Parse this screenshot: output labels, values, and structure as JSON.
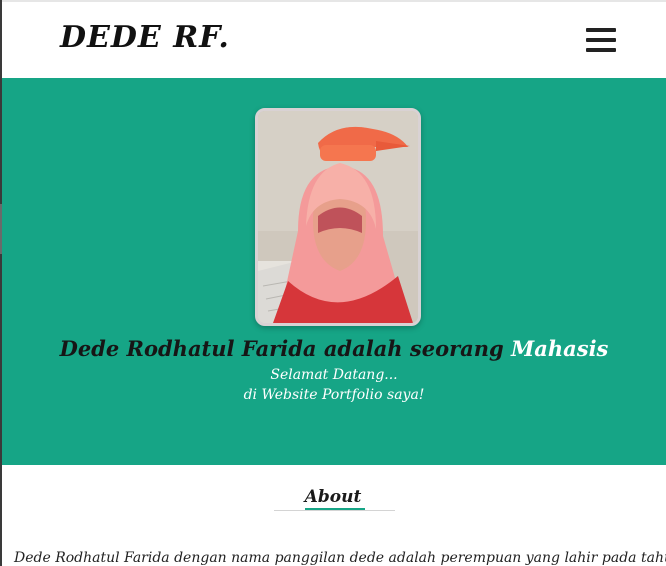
{
  "navbar": {
    "brand": "DEDE RF.",
    "menu_icon": "hamburger-menu-icon"
  },
  "hero": {
    "photo_icon": "profile-photo",
    "headline_prefix": "Dede Rodhatul Farida adalah seorang ",
    "headline_highlight": "Mahasis",
    "greeting_line1": "Selamat Datang...",
    "greeting_line2": "di Website Portfolio saya!"
  },
  "about": {
    "title": "About",
    "text": "Dede Rodhatul Farida dengan nama panggilan dede adalah perempuan yang lahir pada tahun"
  },
  "colors": {
    "hero_background": "#16a586",
    "accent": "#16a586",
    "headline_highlight": "#ffffff"
  }
}
